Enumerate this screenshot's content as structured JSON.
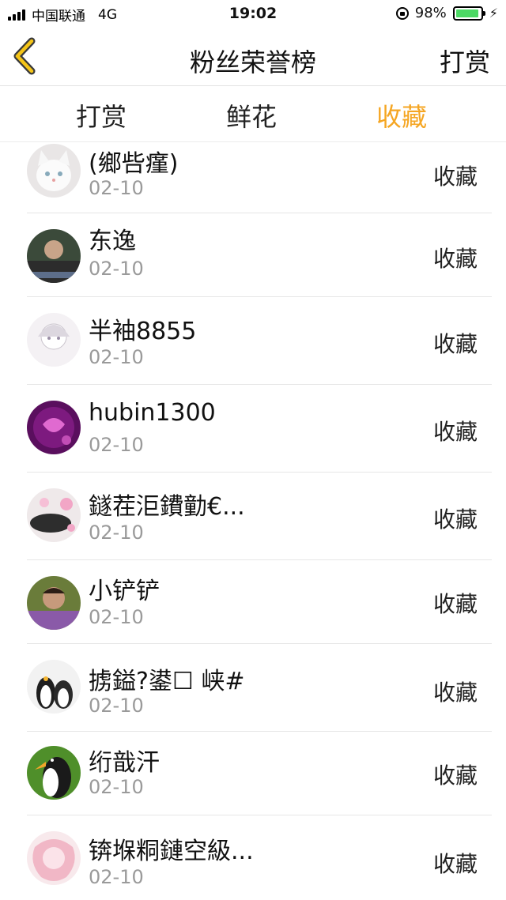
{
  "status_bar": {
    "carrier": "中国联通",
    "network": "4G",
    "time": "19:02",
    "battery": "98%"
  },
  "nav": {
    "title": "粉丝荣誉榜",
    "right_label": "打赏"
  },
  "tabs": [
    {
      "label": "打赏",
      "active": false
    },
    {
      "label": "鲜花",
      "active": false
    },
    {
      "label": "收藏",
      "active": true
    }
  ],
  "accent_color": "#f5a623",
  "list": [
    {
      "name": "(鄉呰瘽)",
      "date": "02-10",
      "type": "收藏"
    },
    {
      "name": "东逸",
      "date": "02-10",
      "type": "收藏"
    },
    {
      "name": "半袖8855",
      "date": "02-10",
      "type": "收藏"
    },
    {
      "name": "hubin1300",
      "date": "02-10",
      "type": "收藏"
    },
    {
      "name": "鐩茬洰鐨勭€...",
      "date": "02-10",
      "type": "收藏"
    },
    {
      "name": "小铲铲",
      "date": "02-10",
      "type": "收藏"
    },
    {
      "name": "掳鎰?鍙☐ 峡#",
      "date": "02-10",
      "type": "收藏"
    },
    {
      "name": "绗戠汗",
      "date": "02-10",
      "type": "收藏"
    },
    {
      "name": "锛堢粡鏈空級...",
      "date": "02-10",
      "type": "收藏"
    }
  ]
}
